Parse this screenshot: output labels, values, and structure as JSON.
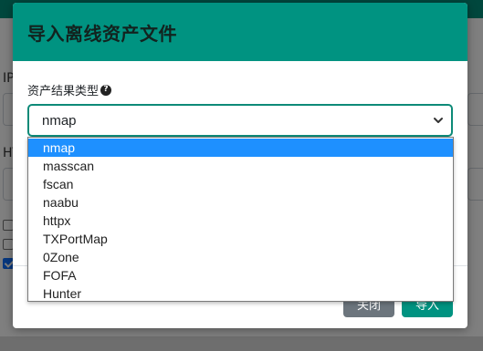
{
  "background": {
    "labels": [
      "IP",
      "HT"
    ]
  },
  "modal": {
    "title": "导入离线资产文件",
    "field_label": "资产结果类型",
    "help_icon": "question-circle-icon",
    "selected_value": "nmap",
    "options": [
      "nmap",
      "masscan",
      "fscan",
      "naabu",
      "httpx",
      "TXPortMap",
      "0Zone",
      "FOFA",
      "Hunter"
    ],
    "footer": {
      "close_label": "关闭",
      "import_label": "导入"
    }
  },
  "colors": {
    "header_bg": "#009381",
    "option_highlight": "#1e90ff",
    "close_button": "#6c757d",
    "primary_button": "#009381"
  }
}
